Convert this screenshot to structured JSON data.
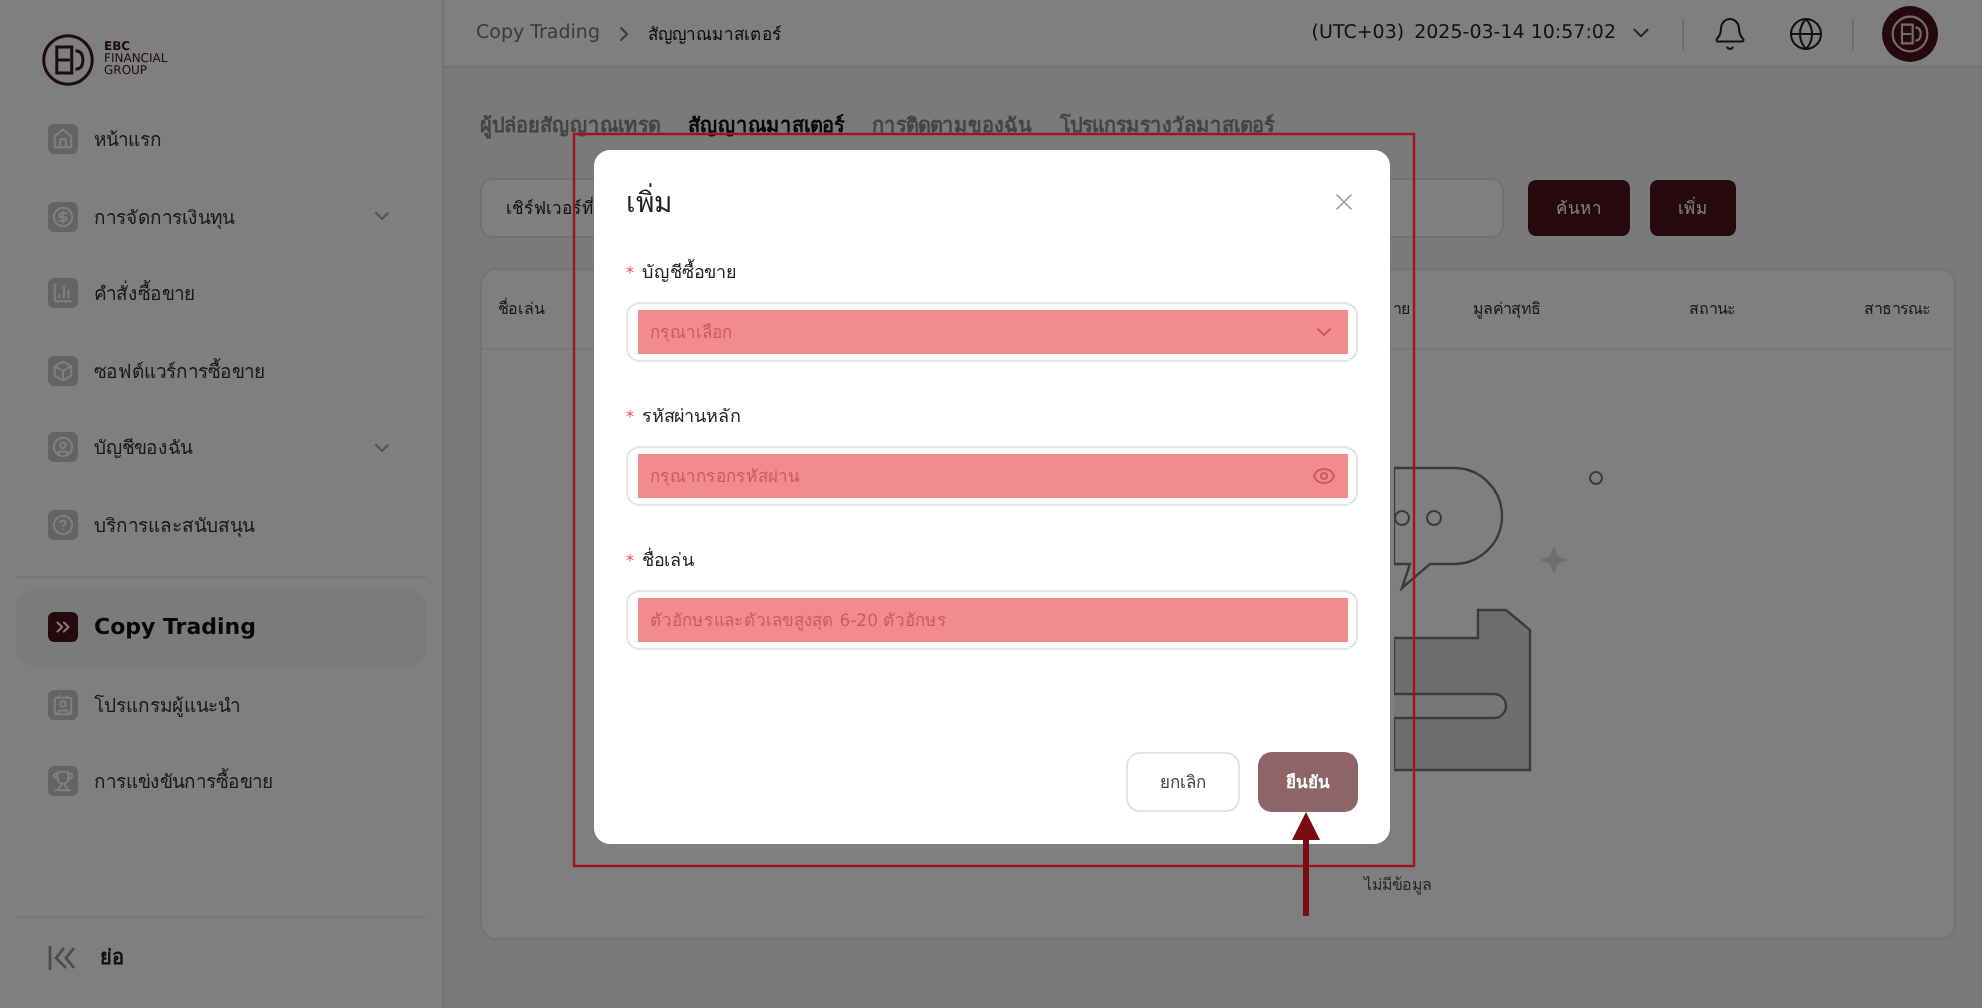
{
  "sidebar": {
    "logo": {
      "line_1": "EBC",
      "line_2": "FINANCIAL",
      "line_3": "GROUP"
    },
    "items": [
      {
        "label": "หน้าแรก",
        "kind": "home",
        "selected": false,
        "expandable": false
      },
      {
        "label": "การจัดการเงินทุน",
        "kind": "money",
        "selected": false,
        "expandable": true
      },
      {
        "label": "คำสั่งซื้อขาย",
        "kind": "chart",
        "selected": false,
        "expandable": false
      },
      {
        "label": "ซอฟต์แวร์การซื้อขาย",
        "kind": "cube",
        "selected": false,
        "expandable": false
      },
      {
        "label": "บัญชีของฉัน",
        "kind": "user",
        "selected": false,
        "expandable": true
      },
      {
        "label": "บริการและสนับสนุน",
        "kind": "help",
        "selected": false,
        "expandable": false
      },
      {
        "label": "Copy Trading",
        "kind": "copy",
        "selected": true,
        "expandable": false
      },
      {
        "label": "โปรแกรมผู้แนะนำ",
        "kind": "contact",
        "selected": false,
        "expandable": false
      },
      {
        "label": "การแข่งขันการซื้อขาย",
        "kind": "trophy",
        "selected": false,
        "expandable": false
      }
    ],
    "collapse": "ย่อ"
  },
  "header": {
    "breadcrumb": [
      "Copy Trading",
      "สัญญาณมาสเตอร์"
    ],
    "timezone": "(UTC+03)",
    "datetime": "2025-03-14 10:57:02"
  },
  "tabs": [
    {
      "label": "ผู้ปล่อยสัญญาณเทรด",
      "selected": false
    },
    {
      "label": "สัญญาณมาสเตอร์",
      "selected": true
    },
    {
      "label": "การติดตามของฉัน",
      "selected": false
    },
    {
      "label": "โปรแกรมรางวัลมาสเตอร์",
      "selected": false
    }
  ],
  "search": {
    "value": "เชิร์ฟเวอร์ที่"
  },
  "search_buttons": [
    "ค้นหา",
    "เพิ่ม"
  ],
  "table": {
    "columns": [
      "ชื่อเล่น",
      "าย",
      "มูลค่าสุทธิ",
      "สถานะ",
      "สาธารณะ"
    ],
    "empty": "ไม่มีข้อมูล"
  },
  "dialog": {
    "title": "เพิ่ม",
    "fields": [
      {
        "required_mark": "*",
        "label": "บัญชีซื้อขาย",
        "placeholder": "กรุณาเลือก",
        "kind": "select"
      },
      {
        "required_mark": "*",
        "label": "รหัสผ่านหลัก",
        "placeholder": "กรุณากรอกรหัสผ่าน",
        "kind": "password"
      },
      {
        "required_mark": "*",
        "label": "ชื่อเล่น",
        "placeholder": "ตัวอักษรและตัวเลขสูงสุด 6-20 ตัวอักษร",
        "kind": "text"
      }
    ],
    "buttons": [
      {
        "label": "ยกเลิก",
        "kind": "secondary"
      },
      {
        "label": "ยืนยัน",
        "kind": "primary"
      }
    ]
  }
}
